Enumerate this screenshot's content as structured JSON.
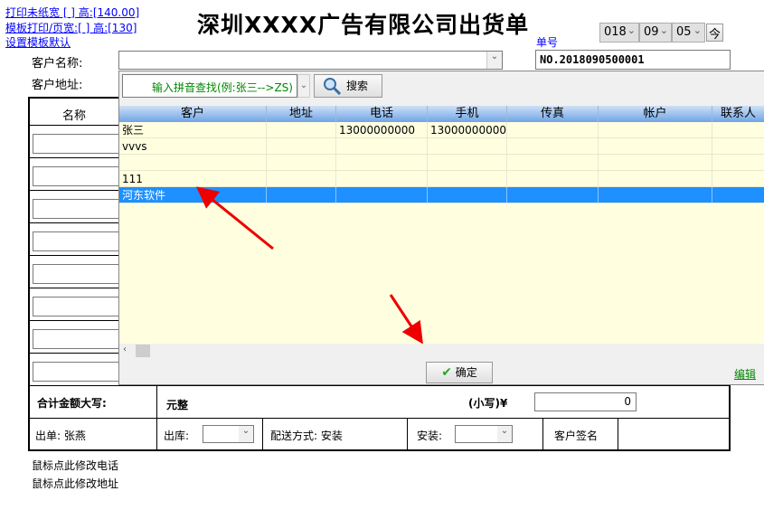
{
  "links": {
    "print_paper": "打印未纸宽 [      ] 高:[140.00]",
    "template_print": "模板打印/页宽:[      ] 高:[130]",
    "set_template": "设置模板默认"
  },
  "title": "深圳XXXX广告有限公司出货单",
  "date": {
    "year": "018",
    "month": "09",
    "day": "05",
    "today_button": "今"
  },
  "order_no": {
    "label": "单号",
    "value": "NO.2018090500001"
  },
  "customer": {
    "name_label": "客户名称:",
    "address_label": "客户地址:"
  },
  "items_header": "名称",
  "popup": {
    "search_placeholder": "输入拼音查找(例:张三-->ZS)",
    "search_button": "搜索",
    "columns": [
      "客户",
      "地址",
      "电话",
      "手机",
      "传真",
      "帐户",
      "联系人"
    ],
    "rows": [
      [
        "张三",
        "",
        "13000000000",
        "13000000000",
        "",
        "",
        ""
      ],
      [
        "vvvs",
        "",
        "",
        "",
        "",
        "",
        ""
      ],
      [
        "",
        "",
        "",
        "",
        "",
        "",
        ""
      ],
      [
        "111",
        "",
        "",
        "",
        "",
        "",
        ""
      ],
      [
        "河东软件",
        "",
        "",
        "",
        "",
        "",
        ""
      ]
    ],
    "selected_row": 4,
    "ok_button": "确定",
    "edit_link": "编辑"
  },
  "totals": {
    "label": "合计金额大写:",
    "uppercase_value": "元整",
    "lowercase_label": "(小写)¥",
    "lowercase_value": "0"
  },
  "footer": {
    "issuer": "出单: 张燕",
    "outbound_label": "出库:",
    "delivery": "配送方式: 安装",
    "install_label": "安装:",
    "signature": "客户签名"
  },
  "notes": [
    "鼠标点此修改电话",
    "鼠标点此修改地址"
  ]
}
